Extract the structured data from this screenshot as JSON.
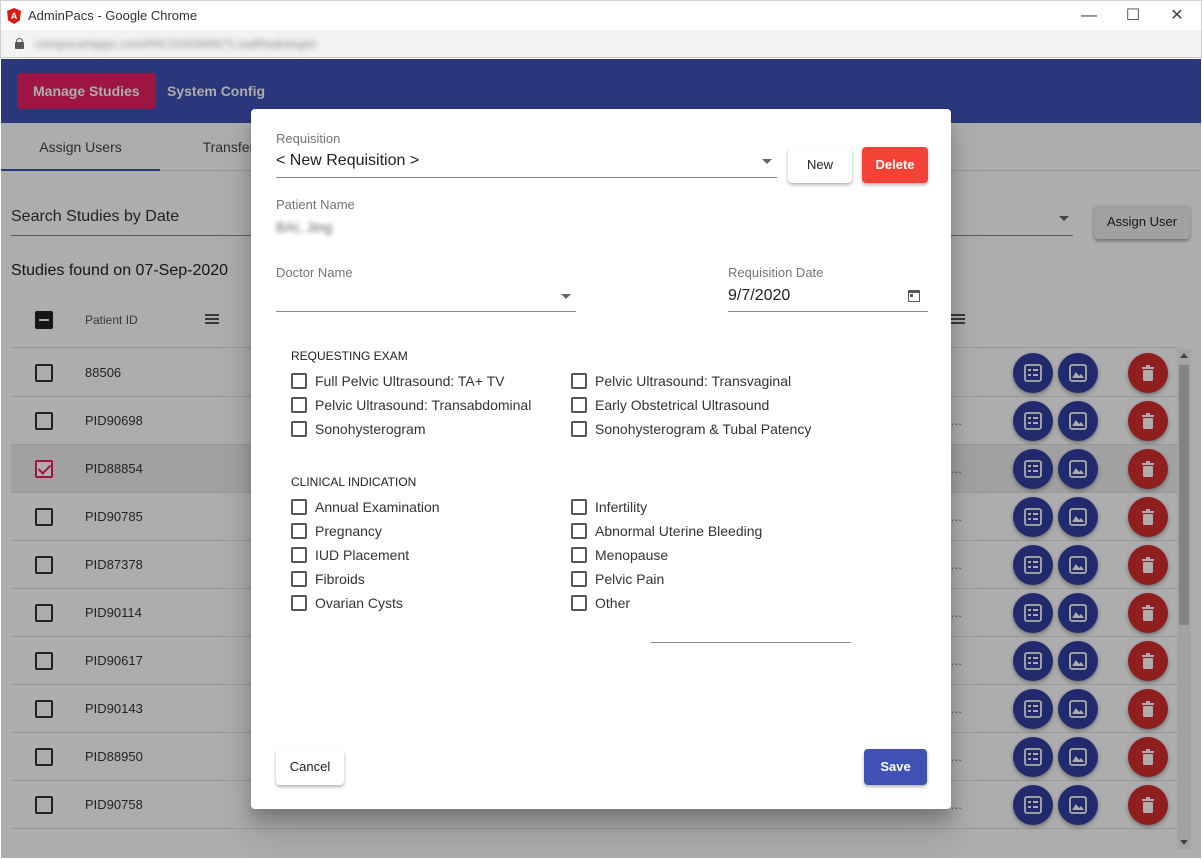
{
  "window": {
    "title": "AdminPacs - Google Chrome",
    "url": "compucartapps.com/PACS/ADMIN/?LoadRadiologist"
  },
  "nav": {
    "manage_studies": "Manage Studies",
    "system_config": "System Config"
  },
  "tabs": [
    "Assign Users",
    "Transfer S"
  ],
  "search": {
    "label": "Search Studies by Date",
    "assign_user": "Assign User",
    "studies_found": "Studies found on 07-Sep-2020"
  },
  "table": {
    "col_patient_id": "Patient ID",
    "rows": [
      {
        "pid": "88506",
        "checked": false,
        "ellipsis": ""
      },
      {
        "pid": "PID90698",
        "checked": false,
        "ellipsis": "..."
      },
      {
        "pid": "PID88854",
        "checked": true,
        "ellipsis": "..."
      },
      {
        "pid": "PID90785",
        "checked": false,
        "ellipsis": "..."
      },
      {
        "pid": "PID87378",
        "checked": false,
        "ellipsis": "..."
      },
      {
        "pid": "PID90114",
        "checked": false,
        "ellipsis": "..."
      },
      {
        "pid": "PID90617",
        "checked": false,
        "ellipsis": "..."
      },
      {
        "pid": "PID90143",
        "checked": false,
        "ellipsis": "..."
      },
      {
        "pid": "PID88950",
        "checked": false,
        "ellipsis": "..."
      },
      {
        "pid": "PID90758",
        "checked": false,
        "ellipsis": "..."
      }
    ]
  },
  "dialog": {
    "requisition_label": "Requisition",
    "requisition_value": "< New Requisition >",
    "new_button": "New",
    "delete_button": "Delete",
    "patient_name_label": "Patient Name",
    "patient_name_value": "BAI, Jing",
    "doctor_name_label": "Doctor Name",
    "doctor_name_value": "",
    "requisition_date_label": "Requisition Date",
    "requisition_date_value": "9/7/2020",
    "requesting_exam_title": "REQUESTING EXAM",
    "requesting_exam": [
      {
        "label": "Full Pelvic Ultrasound: TA+ TV",
        "checked": false
      },
      {
        "label": "Pelvic Ultrasound: Transvaginal",
        "checked": false
      },
      {
        "label": "Pelvic Ultrasound: Transabdominal",
        "checked": false
      },
      {
        "label": "Early Obstetrical Ultrasound",
        "checked": false
      },
      {
        "label": "Sonohysterogram",
        "checked": false
      },
      {
        "label": "Sonohysterogram & Tubal Patency",
        "checked": false
      }
    ],
    "clinical_indication_title": "CLINICAL INDICATION",
    "clinical_indication": [
      {
        "label": "Annual Examination",
        "checked": false
      },
      {
        "label": "Infertility",
        "checked": false
      },
      {
        "label": "Pregnancy",
        "checked": false
      },
      {
        "label": "Abnormal Uterine Bleeding",
        "checked": false
      },
      {
        "label": "IUD Placement",
        "checked": false
      },
      {
        "label": "Menopause",
        "checked": false
      },
      {
        "label": "Fibroids",
        "checked": false
      },
      {
        "label": "Pelvic Pain",
        "checked": false
      },
      {
        "label": "Ovarian Cysts",
        "checked": false
      },
      {
        "label": "Other",
        "checked": false
      }
    ],
    "cancel_button": "Cancel",
    "save_button": "Save"
  },
  "colors": {
    "primary": "#3f51b5",
    "accent": "#e91e63",
    "warn": "#f44336",
    "fab_blue": "#303f9f",
    "fab_red": "#d32f2f"
  }
}
